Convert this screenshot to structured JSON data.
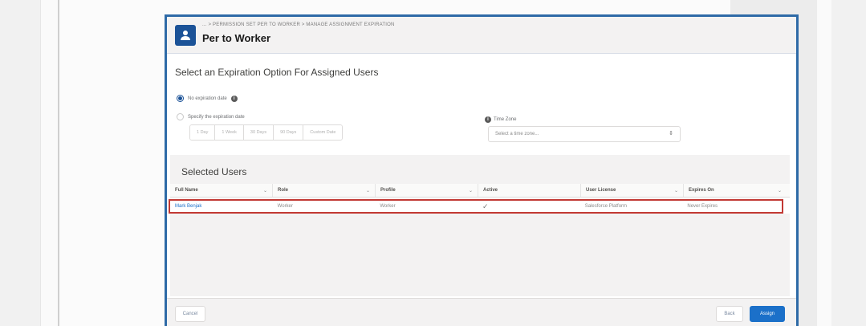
{
  "header": {
    "breadcrumb": "... > PERMISSION SET PER TO WORKER > MANAGE ASSIGNMENT EXPIRATION",
    "title": "Per to Worker",
    "icon": "user-icon"
  },
  "expiration": {
    "section_title": "Select an Expiration Option For Assigned Users",
    "option_none": "No expiration date",
    "option_specify": "Specify the expiration date",
    "durations": [
      "1 Day",
      "1 Week",
      "30 Days",
      "90 Days",
      "Custom Date"
    ],
    "timezone_label": "Time Zone",
    "timezone_placeholder": "Select a time zone..."
  },
  "users": {
    "title": "Selected Users",
    "columns": [
      "Full Name",
      "Role",
      "Profile",
      "Active",
      "User License",
      "Expires On"
    ],
    "rows": [
      {
        "full_name": "Mark Benjak",
        "role": "Worker",
        "profile": "Worker",
        "active": "✓",
        "license": "Salesforce Platform",
        "expires_on": "Never Expires"
      }
    ]
  },
  "footer": {
    "cancel": "Cancel",
    "back": "Back",
    "assign": "Assign"
  },
  "colors": {
    "brand": "#1b70c9",
    "header_icon": "#1b5297",
    "highlight": "#c23934"
  }
}
